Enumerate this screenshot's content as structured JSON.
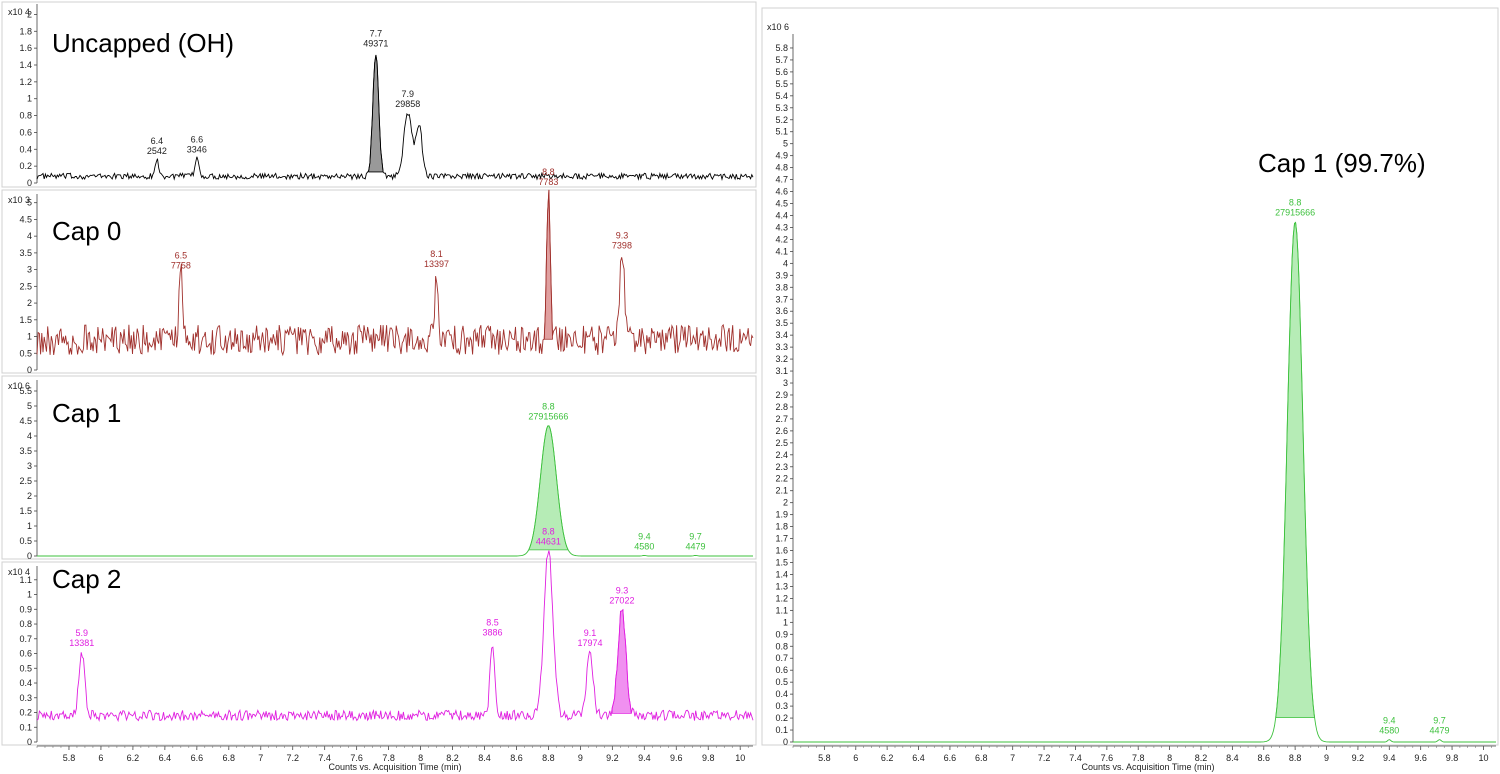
{
  "chart_data": [
    {
      "type": "line",
      "title": "Uncapped (OH)",
      "ylabel_multiplier": "x10 4",
      "yticks": [
        "0",
        "0.2",
        "0.4",
        "0.6",
        "0.8",
        "1",
        "1.2",
        "1.4",
        "1.6",
        "1.8",
        "2"
      ],
      "ylim": [
        0,
        2.1
      ],
      "xlim": [
        5.6,
        10.08
      ],
      "color": "#000000",
      "fill_color": "#999999",
      "noise": 0.07,
      "baseline": 0.08,
      "peaks": [
        {
          "x": 6.35,
          "y": 0.19,
          "w": 0.012,
          "label_time": "6.4",
          "label_area": "2542",
          "fill": false
        },
        {
          "x": 6.6,
          "y": 0.21,
          "w": 0.012,
          "label_time": "6.6",
          "label_area": "3346",
          "fill": false
        },
        {
          "x": 7.72,
          "y": 1.47,
          "w": 0.018,
          "label_time": "7.7",
          "label_area": "49371",
          "fill": true
        },
        {
          "x": 7.92,
          "y": 0.75,
          "w": 0.025,
          "label_time": "7.9",
          "label_area": "29858",
          "fill": false
        },
        {
          "x": 7.99,
          "y": 0.6,
          "w": 0.02,
          "label_time": "",
          "label_area": "",
          "fill": false
        }
      ]
    },
    {
      "type": "line",
      "title": "Cap 0",
      "ylabel_multiplier": "x10 3",
      "yticks": [
        "0",
        "0.5",
        "1",
        "1.5",
        "2",
        "2.5",
        "3",
        "3.5",
        "4",
        "4.5",
        "5"
      ],
      "ylim": [
        0,
        5.2
      ],
      "xlim": [
        5.6,
        10.08
      ],
      "color": "#a0302c",
      "fill_color": "#e0a0a0",
      "noise": 0.9,
      "baseline": 0.9,
      "peaks": [
        {
          "x": 6.5,
          "y": 1.95,
          "w": 0.012,
          "label_time": "6.5",
          "label_area": "7758",
          "fill": false
        },
        {
          "x": 8.1,
          "y": 2.0,
          "w": 0.012,
          "label_time": "8.1",
          "label_area": "13397",
          "fill": false
        },
        {
          "x": 8.8,
          "y": 4.45,
          "w": 0.012,
          "label_time": "8.8",
          "label_area": "7783",
          "fill": true
        },
        {
          "x": 9.26,
          "y": 2.55,
          "w": 0.015,
          "label_time": "9.3",
          "label_area": "7398",
          "fill": false
        }
      ]
    },
    {
      "type": "line",
      "title": "Cap 1",
      "ylabel_multiplier": "x10 6",
      "yticks": [
        "0",
        "0.5",
        "1",
        "1.5",
        "2",
        "2.5",
        "3",
        "3.5",
        "4",
        "4.5",
        "5",
        "5.5"
      ],
      "ylim": [
        0,
        5.8
      ],
      "xlim": [
        5.6,
        10.08
      ],
      "color": "#3ec13e",
      "fill_color": "#b6ecb6",
      "noise": 0.0,
      "baseline": 0.0,
      "peaks": [
        {
          "x": 8.8,
          "y": 4.35,
          "w": 0.05,
          "label_time": "8.8",
          "label_area": "27915666",
          "fill": true
        },
        {
          "x": 9.4,
          "y": 0.02,
          "w": 0.01,
          "label_time": "9.4",
          "label_area": "4580",
          "fill": false
        },
        {
          "x": 9.72,
          "y": 0.02,
          "w": 0.01,
          "label_time": "9.7",
          "label_area": "4479",
          "fill": false
        }
      ]
    },
    {
      "type": "line",
      "title": "Cap 2",
      "ylabel_multiplier": "x10 4",
      "yticks": [
        "0",
        "0.1",
        "0.2",
        "0.3",
        "0.4",
        "0.5",
        "0.6",
        "0.7",
        "0.8",
        "0.9",
        "1",
        "1.1"
      ],
      "ylim": [
        0,
        1.18
      ],
      "xlim": [
        5.6,
        10.08
      ],
      "color": "#e020e0",
      "fill_color": "#f090f0",
      "noise": 0.07,
      "baseline": 0.18,
      "peaks": [
        {
          "x": 5.88,
          "y": 0.43,
          "w": 0.018,
          "label_time": "5.9",
          "label_area": "13381",
          "fill": false
        },
        {
          "x": 8.45,
          "y": 0.5,
          "w": 0.015,
          "label_time": "8.5",
          "label_area": "3886",
          "fill": false
        },
        {
          "x": 8.8,
          "y": 1.12,
          "w": 0.028,
          "label_time": "8.8",
          "label_area": "44631",
          "fill": false
        },
        {
          "x": 9.06,
          "y": 0.43,
          "w": 0.02,
          "label_time": "9.1",
          "label_area": "17974",
          "fill": false
        },
        {
          "x": 9.26,
          "y": 0.72,
          "w": 0.025,
          "label_time": "9.3",
          "label_area": "27022",
          "fill": true
        }
      ]
    },
    {
      "type": "line",
      "title": "Cap 1 (99.7%)",
      "ylabel_multiplier": "x10 6",
      "yticks": [
        "0",
        "0.1",
        "0.2",
        "0.3",
        "0.4",
        "0.5",
        "0.6",
        "0.7",
        "0.8",
        "0.9",
        "1",
        "1.1",
        "1.2",
        "1.3",
        "1.4",
        "1.5",
        "1.6",
        "1.7",
        "1.8",
        "1.9",
        "2",
        "2.1",
        "2.2",
        "2.3",
        "2.4",
        "2.5",
        "2.6",
        "2.7",
        "2.8",
        "2.9",
        "3",
        "3.1",
        "3.2",
        "3.3",
        "3.4",
        "3.5",
        "3.6",
        "3.7",
        "3.8",
        "3.9",
        "4",
        "4.1",
        "4.2",
        "4.3",
        "4.4",
        "4.5",
        "4.6",
        "4.7",
        "4.8",
        "4.9",
        "5",
        "5.1",
        "5.2",
        "5.3",
        "5.4",
        "5.5",
        "5.6",
        "5.7",
        "5.8"
      ],
      "ylim": [
        0,
        5.9
      ],
      "xlim": [
        5.6,
        10.08
      ],
      "color": "#3ec13e",
      "fill_color": "#b6ecb6",
      "noise": 0.0,
      "baseline": 0.0,
      "peaks": [
        {
          "x": 8.8,
          "y": 4.35,
          "w": 0.05,
          "label_time": "8.8",
          "label_area": "27915666",
          "fill": true
        },
        {
          "x": 9.4,
          "y": 0.02,
          "w": 0.01,
          "label_time": "9.4",
          "label_area": "4580",
          "fill": false
        },
        {
          "x": 9.72,
          "y": 0.02,
          "w": 0.01,
          "label_time": "9.7",
          "label_area": "4479",
          "fill": false
        }
      ]
    }
  ],
  "x_axis": {
    "ticks": [
      "5.8",
      "6",
      "6.2",
      "6.4",
      "6.6",
      "6.8",
      "7",
      "7.2",
      "7.4",
      "7.6",
      "7.8",
      "8",
      "8.2",
      "8.4",
      "8.6",
      "8.8",
      "9",
      "9.2",
      "9.4",
      "9.6",
      "9.8",
      "10"
    ],
    "label": "Counts vs. Acquisition Time (min)"
  }
}
